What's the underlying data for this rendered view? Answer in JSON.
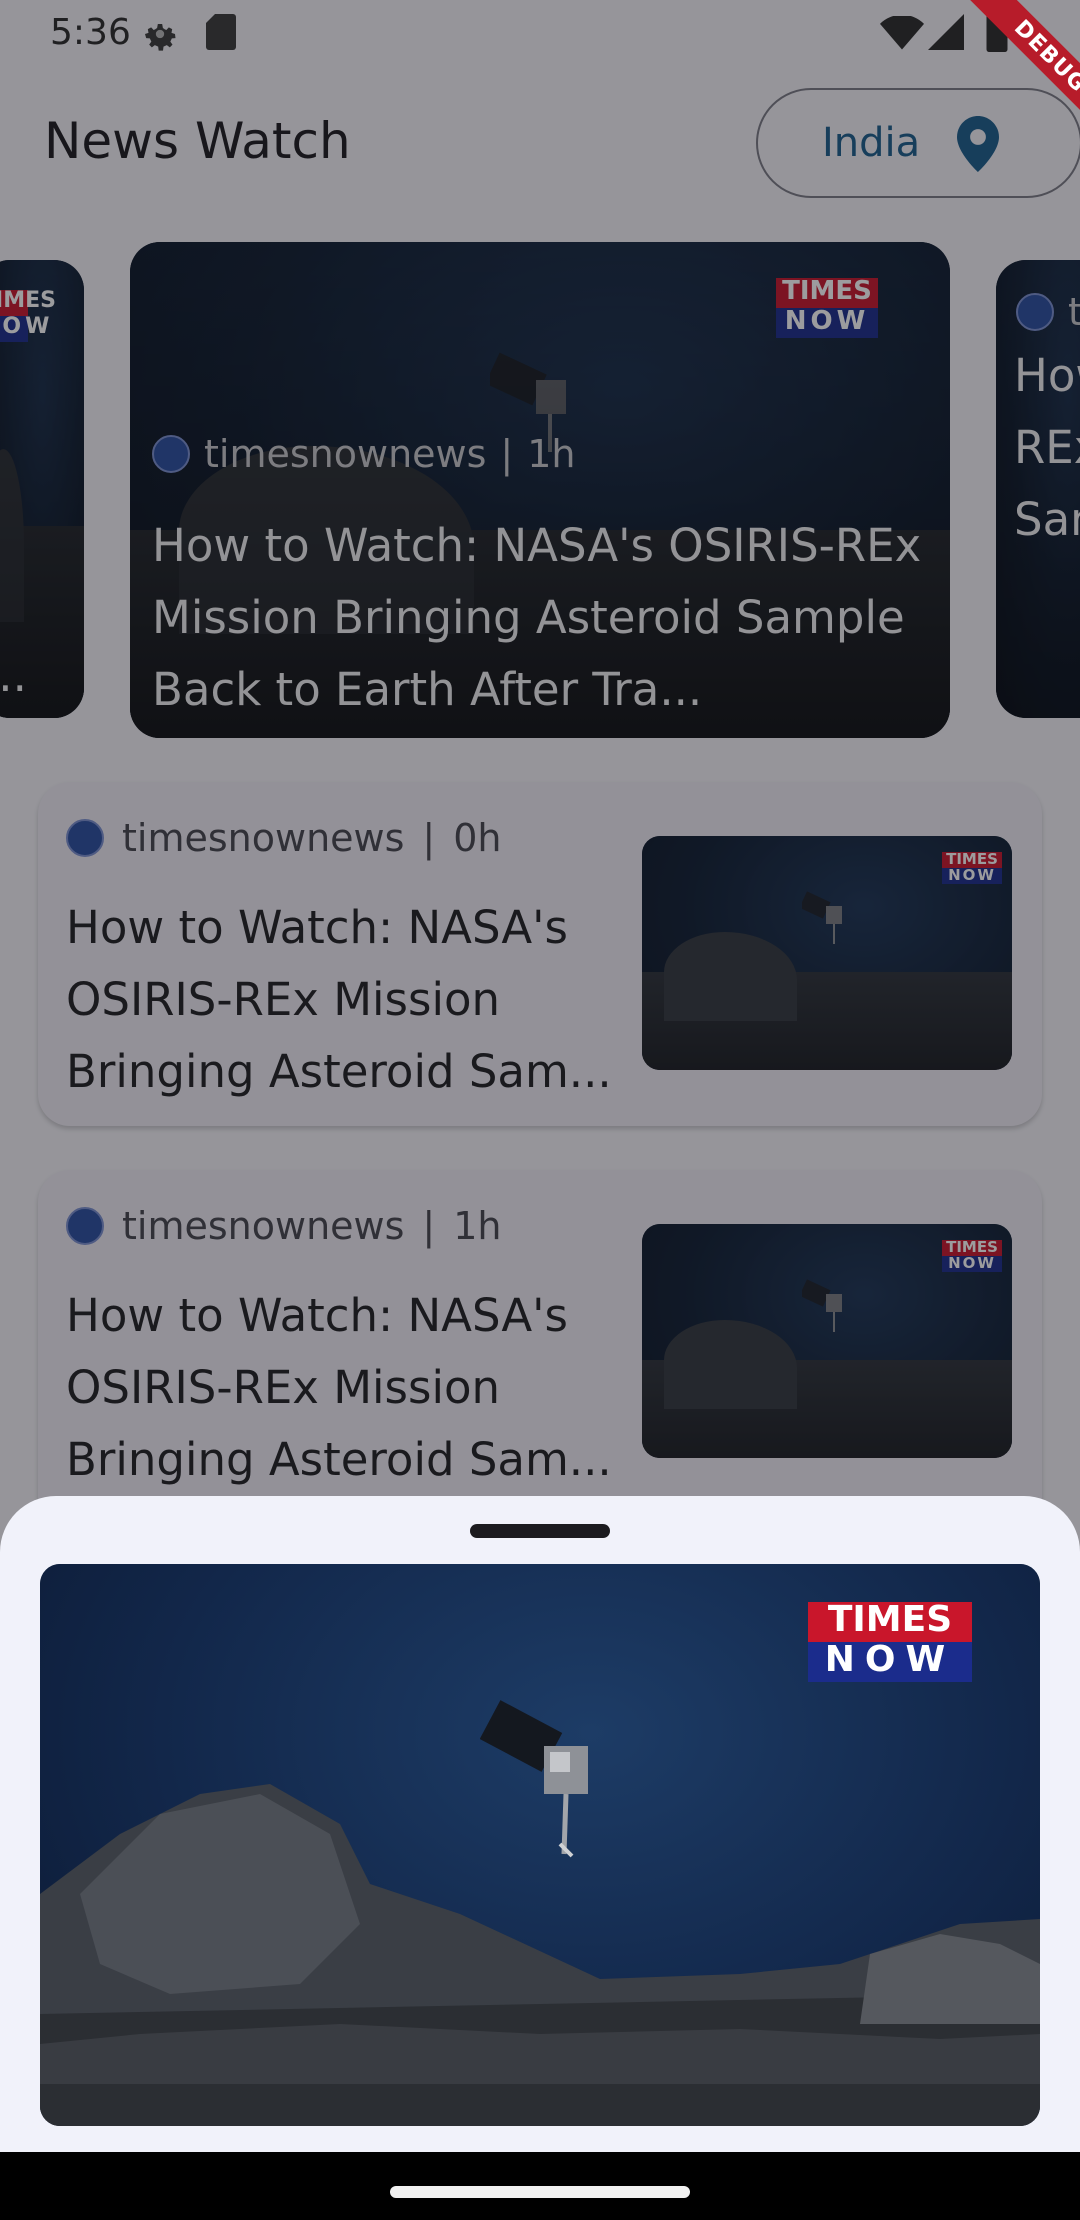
{
  "status_bar": {
    "time": "5:36",
    "icons": [
      "settings-gear-icon",
      "sd-card-icon",
      "wifi-icon",
      "cell-signal-icon",
      "battery-icon"
    ]
  },
  "debug_banner": {
    "label": "DEBUG",
    "color": "#b71c2a"
  },
  "app_bar": {
    "title": "News Watch",
    "country_button": {
      "label": "India",
      "icon": "location-pin-icon",
      "accent": "#1b5d8c"
    }
  },
  "carousel": {
    "cards": [
      {
        "position": "left-partial",
        "title_snippet": "..."
      },
      {
        "position": "center",
        "source": "timesnownews",
        "time": "1h",
        "title": "How to Watch: NASA's OSIRIS-REx Mission Bringing Asteroid Sample Back to Earth After Tra...",
        "logo_top": "TIMES",
        "logo_bottom": "NOW"
      },
      {
        "position": "right-partial",
        "source": "t",
        "title_snippet": "How REx San"
      }
    ]
  },
  "list": [
    {
      "source": "timesnownews",
      "separator": "|",
      "time": "0h",
      "title": "How to Watch: NASA's OSIRIS-REx Mission Bringing Asteroid Sam...",
      "logo_top": "TIMES",
      "logo_bottom": "NOW"
    },
    {
      "source": "timesnownews",
      "separator": "|",
      "time": "1h",
      "title": "How to Watch: NASA's OSIRIS-REx Mission Bringing Asteroid Sam...",
      "logo_top": "TIMES",
      "logo_bottom": "NOW"
    }
  ],
  "sheet": {
    "logo_top": "TIMES",
    "logo_bottom": "NOW"
  }
}
